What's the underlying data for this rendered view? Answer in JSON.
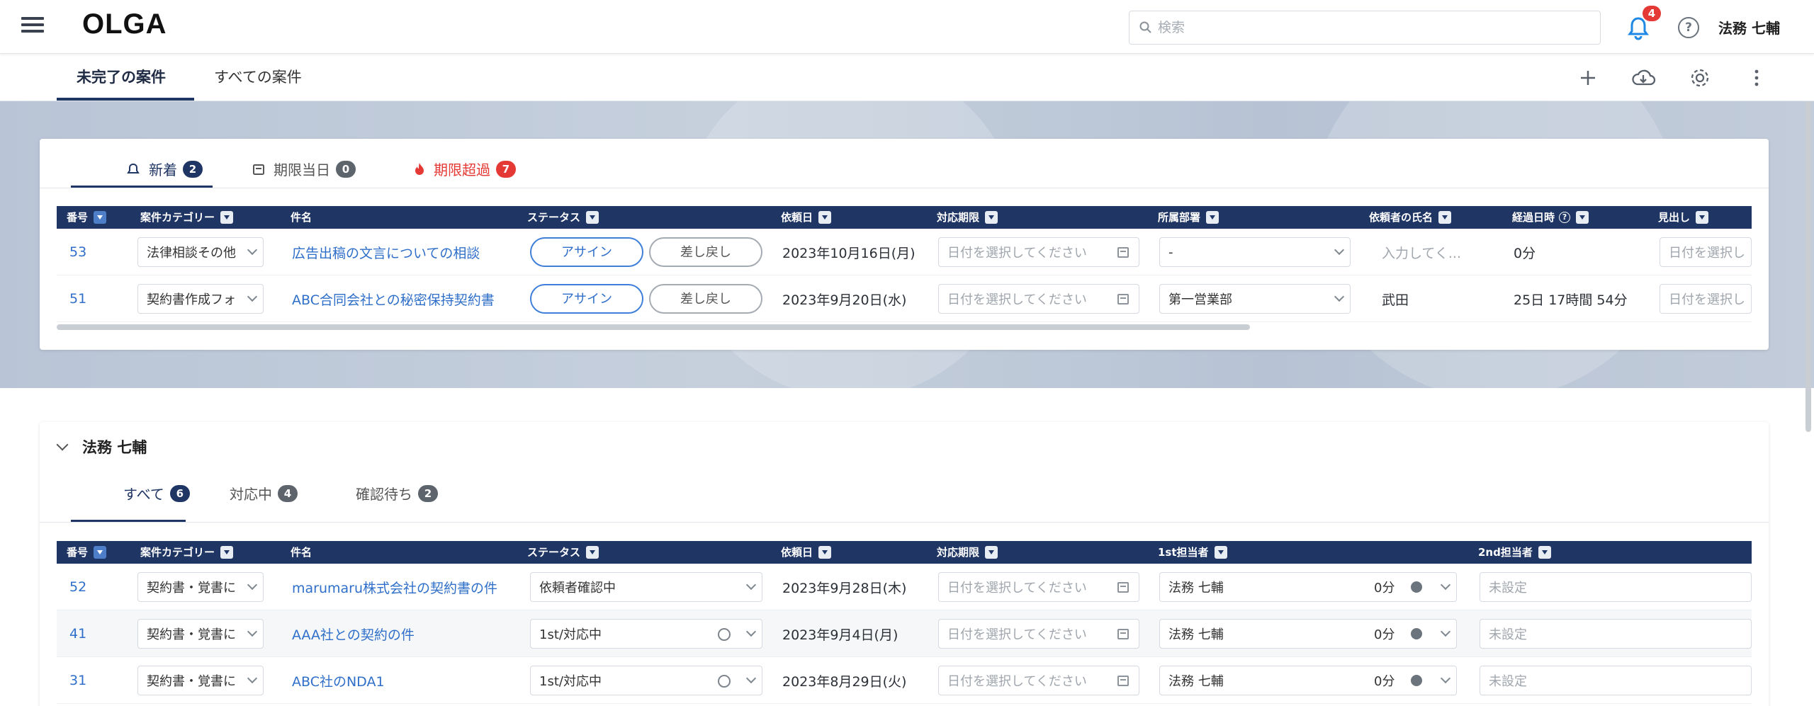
{
  "header": {
    "logo": "OLGA",
    "search_placeholder": "検索",
    "notification_count": "4",
    "username": "法務 七輔"
  },
  "main_tabs": {
    "incomplete": "未完了の案件",
    "all": "すべての案件"
  },
  "alerts_card": {
    "tabs": [
      {
        "label": "新着",
        "count": "2"
      },
      {
        "label": "期限当日",
        "count": "0"
      },
      {
        "label": "期限超過",
        "count": "7"
      }
    ],
    "columns": [
      "番号",
      "案件カテゴリー",
      "件名",
      "ステータス",
      "依頼日",
      "対応期限",
      "所属部署",
      "依頼者の氏名",
      "経過日時",
      "見出し"
    ],
    "rows": [
      {
        "id": "53",
        "category": "法律相談その他",
        "subject": "広告出稿の文言についての相談",
        "status_primary": "アサイン",
        "status_secondary": "差し戻し",
        "request_date": "2023年10月16日(月)",
        "due_placeholder": "日付を選択してください",
        "department": "-",
        "requester": "入力してく...",
        "elapsed": "0分",
        "heading": "日付を選択し"
      },
      {
        "id": "51",
        "category": "契約書作成フォ",
        "subject": "ABC合同会社との秘密保持契約書",
        "status_primary": "アサイン",
        "status_secondary": "差し戻し",
        "request_date": "2023年9月20日(水)",
        "due_placeholder": "日付を選択してください",
        "department": "第一営業部",
        "requester": "武田",
        "elapsed": "25日 17時間 54分",
        "heading": "日付を選択し"
      }
    ]
  },
  "assignee_card": {
    "title": "法務 七輔",
    "tabs": [
      {
        "label": "すべて",
        "count": "6"
      },
      {
        "label": "対応中",
        "count": "4"
      },
      {
        "label": "確認待ち",
        "count": "2"
      }
    ],
    "columns": [
      "番号",
      "案件カテゴリー",
      "件名",
      "ステータス",
      "依頼日",
      "対応期限",
      "1st担当者",
      "2nd担当者"
    ],
    "rows": [
      {
        "id": "52",
        "category": "契約書・覚書に",
        "subject": "marumaru株式会社の契約書の件",
        "status": "依頼者確認中",
        "request_date": "2023年9月28日(木)",
        "due_placeholder": "日付を選択してください",
        "first": "法務 七輔",
        "time": "0分",
        "second": "未設定"
      },
      {
        "id": "41",
        "category": "契約書・覚書に",
        "subject": "AAA社との契約の件",
        "status": "1st/対応中",
        "request_date": "2023年9月4日(月)",
        "due_placeholder": "日付を選択してください",
        "first": "法務 七輔",
        "time": "0分",
        "second": "未設定"
      },
      {
        "id": "31",
        "category": "契約書・覚書に",
        "subject": "ABC社のNDA1",
        "status": "1st/対応中",
        "request_date": "2023年8月29日(火)",
        "due_placeholder": "日付を選択してください",
        "first": "法務 七輔",
        "time": "0分",
        "second": "未設定"
      }
    ]
  },
  "colors": {
    "navy": "#1f3564",
    "link": "#2f6fc9",
    "alert_red": "#e53935"
  },
  "icons": [
    "menu-icon",
    "search-icon",
    "bell-icon",
    "help-icon",
    "plus-icon",
    "cloud-download-icon",
    "gear-icon",
    "more-vert-icon",
    "calendar-icon",
    "fire-icon",
    "chevron-down-icon"
  ]
}
